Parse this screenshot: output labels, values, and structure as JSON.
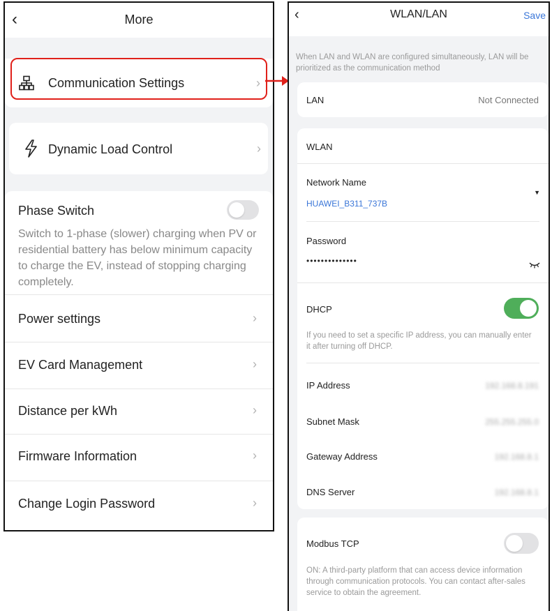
{
  "left": {
    "title": "More",
    "items": [
      {
        "label": "Communication Settings",
        "icon": "network-icon"
      },
      {
        "label": "Dynamic Load Control",
        "icon": "lightning-icon"
      }
    ],
    "phase_switch": {
      "label": "Phase Switch",
      "enabled": false,
      "description": "Switch to 1-phase (slower) charging when PV or residential battery has below minimum capacity to charge the EV, instead of stopping charging completely."
    },
    "menu": [
      "Power settings",
      "EV Card Management",
      "Distance per kWh",
      "Firmware Information",
      "Change Login Password"
    ]
  },
  "right": {
    "title": "WLAN/LAN",
    "save_label": "Save",
    "note": "When LAN and WLAN are configured simultaneously, LAN will be prioritized as the communication method",
    "lan": {
      "label": "LAN",
      "status": "Not Connected"
    },
    "wlan": {
      "label": "WLAN",
      "network_name_label": "Network Name",
      "network_name_value": "HUAWEI_B311_737B",
      "password_label": "Password",
      "password_value": "••••••••••••••"
    },
    "dhcp": {
      "label": "DHCP",
      "enabled": true,
      "note": "If you need to set a specific IP address, you can manually enter it after turning off DHCP."
    },
    "fields": [
      {
        "label": "IP Address",
        "value": "192.168.8.191"
      },
      {
        "label": "Subnet Mask",
        "value": "255.255.255.0"
      },
      {
        "label": "Gateway Address",
        "value": "192.168.8.1"
      },
      {
        "label": "DNS Server",
        "value": "192.168.8.1"
      }
    ],
    "modbus": {
      "label": "Modbus TCP",
      "enabled": false,
      "note": "ON: A third-party platform that can access device information through communication protocols. You can contact after-sales service to obtain the agreement."
    }
  },
  "colors": {
    "accent_blue": "#3a76d8",
    "toggle_on": "#4fae5a",
    "highlight_red": "#e0201a"
  }
}
